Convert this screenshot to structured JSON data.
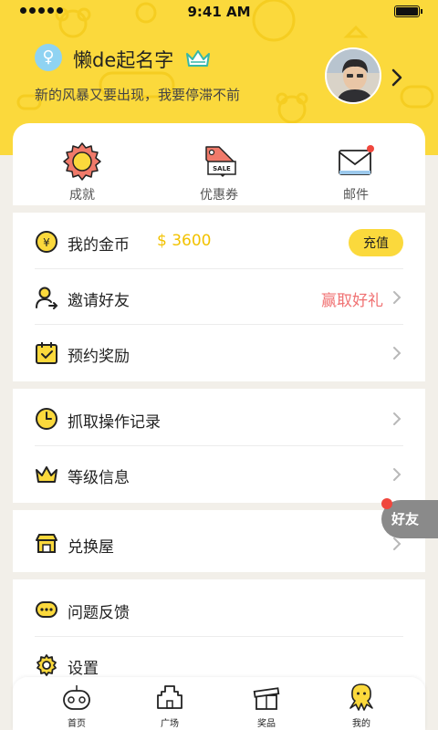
{
  "status_bar": {
    "time": "9:41 AM"
  },
  "profile": {
    "gender_symbol": "♀",
    "username": "懒de起名字",
    "signature": "新的风暴又要出现，我要停滞不前"
  },
  "quick_actions": [
    {
      "label": "成就",
      "icon": "medal-icon"
    },
    {
      "label": "优惠券",
      "icon": "sale-tag-icon"
    },
    {
      "label": "邮件",
      "icon": "mail-icon"
    }
  ],
  "menu": {
    "coins": {
      "label": "我的金币",
      "amount": "$ 3600",
      "button": "充值"
    },
    "invite": {
      "label": "邀请好友",
      "reward": "赢取好礼"
    },
    "reservation": {
      "label": "预约奖励"
    },
    "grab_records": {
      "label": "抓取操作记录"
    },
    "level": {
      "label": "等级信息"
    },
    "exchange": {
      "label": "兑换屋"
    },
    "feedback": {
      "label": "问题反馈"
    },
    "settings": {
      "label": "设置"
    }
  },
  "friends_float": {
    "label": "好友"
  },
  "tabs": [
    {
      "label": "首页",
      "icon": "gamepad-icon"
    },
    {
      "label": "广场",
      "icon": "castle-icon"
    },
    {
      "label": "奖品",
      "icon": "gift-box-icon"
    },
    {
      "label": "我的",
      "icon": "octopus-icon",
      "active": true
    }
  ],
  "colors": {
    "brand_yellow": "#fbd93c",
    "coin_gold": "#f2c200",
    "reward_red": "#f07172",
    "notification_red": "#f0473d"
  }
}
